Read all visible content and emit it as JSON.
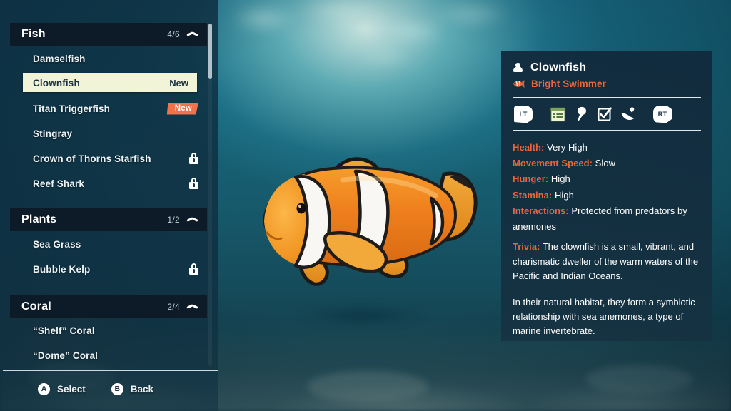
{
  "sidebar": {
    "scrollbar": {
      "name": "category-list-scrollbar"
    },
    "categories": [
      {
        "id": "fish",
        "title": "Fish",
        "count": "4/6",
        "collapse_icon": "chevron-up-icon",
        "entries": [
          {
            "label": "Damselfish",
            "state": "unlocked",
            "badge": ""
          },
          {
            "label": "Clownfish",
            "state": "selected",
            "badge": "New"
          },
          {
            "label": "Titan Triggerfish",
            "state": "unlocked",
            "badge": "New"
          },
          {
            "label": "Stingray",
            "state": "unlocked",
            "badge": ""
          },
          {
            "label": "Crown of Thorns Starfish",
            "state": "locked",
            "badge": ""
          },
          {
            "label": "Reef Shark",
            "state": "locked",
            "badge": ""
          }
        ]
      },
      {
        "id": "plants",
        "title": "Plants",
        "count": "1/2",
        "collapse_icon": "chevron-up-icon",
        "entries": [
          {
            "label": "Sea Grass",
            "state": "unlocked",
            "badge": ""
          },
          {
            "label": "Bubble Kelp",
            "state": "locked",
            "badge": ""
          }
        ]
      },
      {
        "id": "coral",
        "title": "Coral",
        "count": "2/4",
        "collapse_icon": "chevron-up-icon",
        "entries": [
          {
            "label": "“Shelf” Coral",
            "state": "unlocked",
            "badge": ""
          },
          {
            "label": "“Dome” Coral",
            "state": "unlocked",
            "badge": ""
          }
        ]
      }
    ]
  },
  "footer": {
    "actions": [
      {
        "glyph": "A",
        "label": "Select"
      },
      {
        "glyph": "B",
        "label": "Back"
      }
    ]
  },
  "detail": {
    "title_icon": "person-icon",
    "title": "Clownfish",
    "subtitle_icon": "clownfish-icon",
    "subtitle": "Bright Swimmer",
    "tabs": {
      "left_bumper": "LT",
      "right_bumper": "RT",
      "items": [
        {
          "icon": "stats-list-icon",
          "selected": true
        },
        {
          "icon": "food-drumstick-icon",
          "selected": false
        },
        {
          "icon": "task-checkbox-icon",
          "selected": false
        },
        {
          "icon": "care-hand-heart-icon",
          "selected": false
        }
      ]
    },
    "stats": [
      {
        "key": "Health:",
        "value": "Very High"
      },
      {
        "key": "Movement Speed:",
        "value": "Slow"
      },
      {
        "key": "Hunger:",
        "value": "High"
      },
      {
        "key": "Stamina:",
        "value": "High"
      },
      {
        "key": "Interactions:",
        "value": "Protected from predators by anemones"
      }
    ],
    "trivia": {
      "key": "Trivia:",
      "text": "The clownfish is a small, vibrant, and charismatic dweller of the warm waters of the Pacific and Indian Oceans.",
      "paragraph2": "In their natural habitat, they form a symbiotic relationship with sea anemones, a type of marine invertebrate."
    }
  },
  "colors": {
    "accent_orange": "#e8663c",
    "badge_new": "#f0714a",
    "selected_row": "#f2f4d7",
    "panel_bg": "#11293b",
    "header_bg": "#0d1b28"
  }
}
